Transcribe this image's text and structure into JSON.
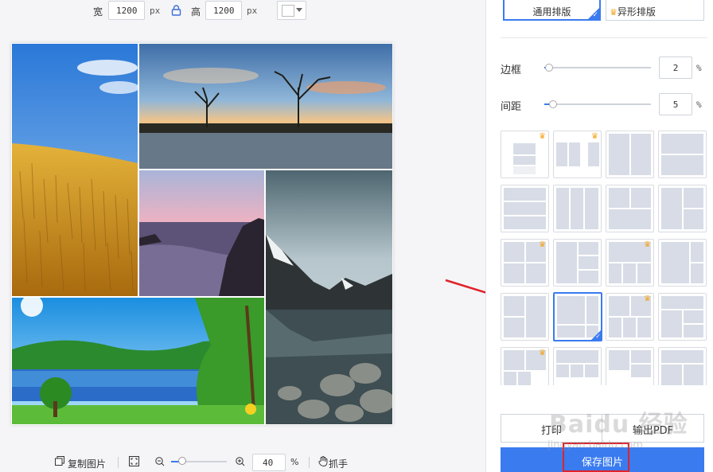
{
  "size_bar": {
    "width_label": "宽",
    "width_value": "1200",
    "height_label": "高",
    "height_value": "1200",
    "unit": "px",
    "lock_icon": "lock-icon",
    "bg_color": "#ffffff"
  },
  "toolbar": {
    "copy_label": "复制图片",
    "zoom_value": "40",
    "zoom_unit": "%",
    "hand_label": "抓手",
    "zoom_level": 0.2
  },
  "panel": {
    "tab_general": "通用排版",
    "tab_special": "异形排版",
    "border_label": "边框",
    "border_value": "2",
    "spacing_label": "间距",
    "spacing_value": "5",
    "percent": "%",
    "print_label": "打印",
    "export_pdf_label": "输出PDF",
    "save_label": "保存图片"
  },
  "watermark": {
    "main": "Baidu 经验",
    "sub": "jingyan.baidu.com"
  },
  "colors": {
    "accent": "#3a7bf0",
    "crown": "#f5a623",
    "annotation": "#e0232a"
  }
}
